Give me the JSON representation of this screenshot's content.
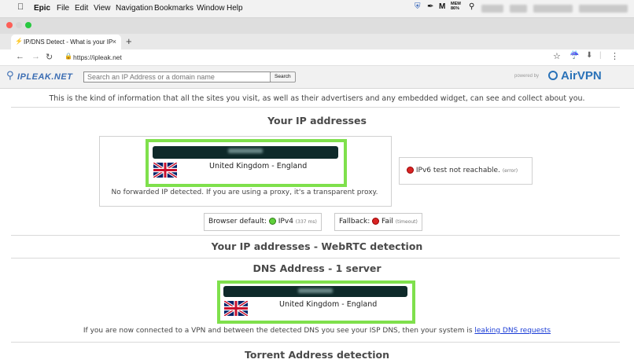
{
  "menubar": {
    "app": "Epic",
    "items": [
      "File",
      "Edit",
      "View",
      "Navigation",
      "Bookmarks",
      "Window",
      "Help"
    ],
    "status_mem": "MEM\n86%"
  },
  "tab": {
    "title": "IP/DNS Detect - What is your IP",
    "close": "×",
    "new_tab": "+"
  },
  "address_bar": {
    "url": "https://ipleak.net"
  },
  "site_header": {
    "logo": "IPLEAK.NET",
    "search_placeholder": "Search an IP Address or a domain name",
    "search_button": "Search",
    "powered_by": "powered by",
    "brand": "AirVPN"
  },
  "info_text": "This is the kind of information that all the sites you visit, as well as their advertisers and any embedded widget, can see and collect about you.",
  "ip_section": {
    "heading": "Your IP addresses",
    "country": "United Kingdom - England",
    "forwarded_note": "No forwarded IP detected. If you are using a proxy, it's a transparent proxy.",
    "ipv6_text": "IPv6 test not reachable.",
    "ipv6_tag": "(error)",
    "browser_default_label": "Browser default:",
    "browser_default_value": "IPv4",
    "browser_default_ms": "(337 ms)",
    "fallback_label": "Fallback:",
    "fallback_value": "Fail",
    "fallback_tag": "(timeout)"
  },
  "webrtc_section": {
    "heading": "Your IP addresses - WebRTC detection"
  },
  "dns_section": {
    "heading": "DNS Address - 1 server",
    "country": "United Kingdom - England",
    "note_prefix": "If you are now connected to a VPN and between the detected DNS you see your ISP DNS, then your system is",
    "note_link": "leaking DNS requests"
  },
  "torrent_section": {
    "heading": "Torrent Address detection"
  },
  "colors": {
    "highlight": "#7fe04c",
    "brand": "#2a72b8",
    "ip_bar": "#0e2a2a"
  }
}
